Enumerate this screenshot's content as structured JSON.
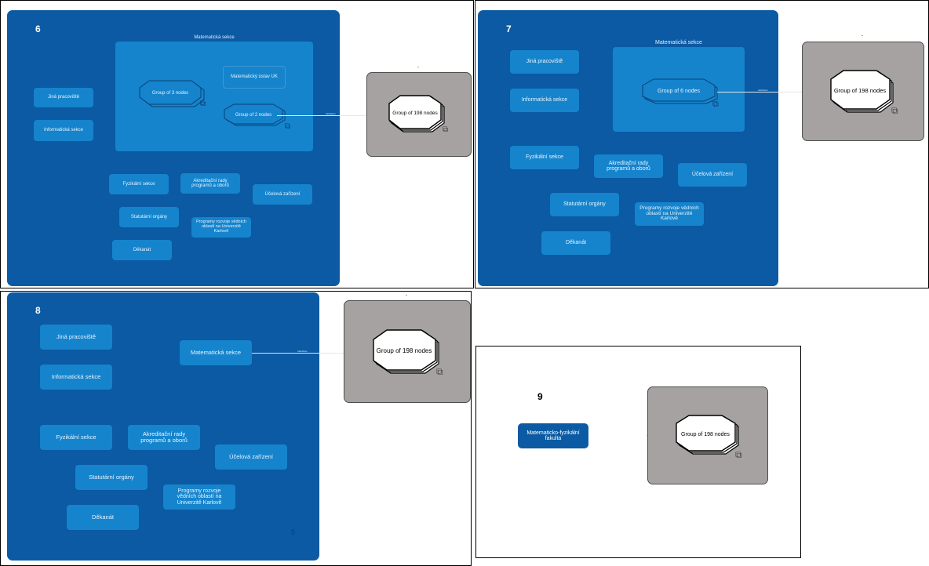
{
  "colors": {
    "panel": "#0b5aa3",
    "node": "#1584cc",
    "node_text": "#e8f3ff",
    "grey_box": "#a6a2a2",
    "octagon_outline": "#000000"
  },
  "frames": {
    "f6": {
      "number": "6",
      "section_title": "Matematická sekce",
      "group_a": "Group of 3 nodes",
      "group_b": "Group of 2 nodes",
      "inner_node": "Matematický ústav UK",
      "big_group": "Group of 198 nodes",
      "edge_label": "záležitost",
      "top_mark": "-",
      "nodes": {
        "jina": "Jiná pracoviště",
        "informaticka": "Informatická sekce",
        "fyzikalni": "Fyzikální sekce",
        "akreditacni": "Akreditační rady programů a oborů",
        "ucelova": "Účelová zařízení",
        "statutarni": "Statutární orgány",
        "programy": "Programy rozvoje vědních oblastí na Univerzitě Karlově",
        "dekanat": "Děkanát"
      }
    },
    "f7": {
      "number": "7",
      "section_title": "Matematická sekce",
      "group_a": "Group of 6 nodes",
      "big_group": "Group of 198 nodes",
      "edge_label": "záležitost",
      "top_mark": "-",
      "nodes": {
        "jina": "Jiná pracoviště",
        "informaticka": "Informatická sekce",
        "fyzikalni": "Fyzikální sekce",
        "akreditacni": "Akreditační rady programů a oborů",
        "ucelova": "Účelová zařízení",
        "statutarni": "Statutární orgány",
        "programy": "Programy rozvoje vědních oblastí na Univerzitě Karlově",
        "dekanat": "Děkanát"
      }
    },
    "f8": {
      "number": "8",
      "matematicka": "Matematická sekce",
      "big_group": "Group of 198 nodes",
      "edge_label": "záležitost",
      "top_mark": "-",
      "corner_mark": "5",
      "nodes": {
        "jina": "Jiná pracoviště",
        "informaticka": "Informatická sekce",
        "fyzikalni": "Fyzikální sekce",
        "akreditacni": "Akreditační rady programů a oborů",
        "ucelova": "Účelová zařízení",
        "statutarni": "Statutární orgány",
        "programy": "Programy rozvoje vědních oblastí na Univerzitě Karlově",
        "dekanat": "Děkanát"
      }
    },
    "f9": {
      "number": "9",
      "faculty": "Matematicko-fyzikální fakulta",
      "big_group": "Group of 198 nodes"
    }
  }
}
